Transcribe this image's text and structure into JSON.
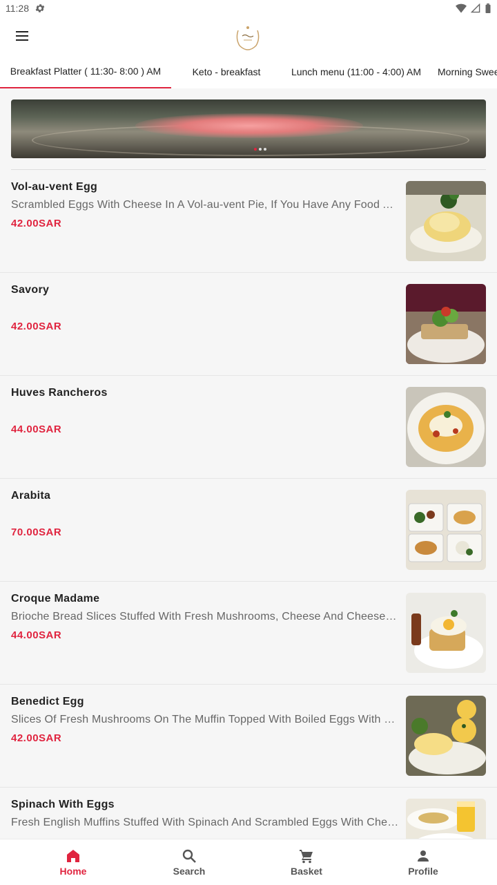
{
  "status_bar": {
    "time": "11:28"
  },
  "tabs": [
    {
      "label": "Breakfast Platter ( 11:30- 8:00 ) AM"
    },
    {
      "label": "Keto - breakfast"
    },
    {
      "label": "Lunch menu (11:00 - 4:00) AM"
    },
    {
      "label": "Morning Sweet"
    }
  ],
  "menu_items": [
    {
      "name": "Vol-au-vent Egg",
      "description": "Scrambled Eggs With Cheese In A Vol-au-vent Pie, If You Have Any Food Allergies",
      "price": "42.00SAR"
    },
    {
      "name": "Savory",
      "description": "",
      "price": "42.00SAR"
    },
    {
      "name": "Huves Rancheros",
      "description": "",
      "price": "44.00SAR"
    },
    {
      "name": "Arabita",
      "description": "",
      "price": "70.00SAR"
    },
    {
      "name": "Croque Madame",
      "description": "Brioche Bread Slices Stuffed With Fresh Mushrooms, Cheese And Cheese Sauce",
      "price": "44.00SAR"
    },
    {
      "name": "Benedict Egg",
      "description": "Slices Of Fresh Mushrooms On The Muffin Topped With Boiled Eggs With Hollandaise",
      "price": "42.00SAR"
    },
    {
      "name": "Spinach With Eggs",
      "description": "Fresh English Muffins Stuffed With Spinach And Scrambled Eggs With Cheese",
      "price": ""
    }
  ],
  "bottom_nav": {
    "home": "Home",
    "search": "Search",
    "basket": "Basket",
    "profile": "Profile"
  },
  "colors": {
    "accent": "#e0243f"
  }
}
